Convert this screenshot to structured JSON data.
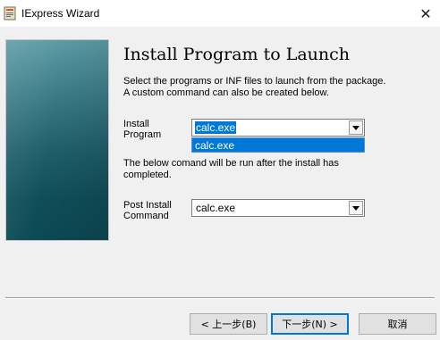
{
  "window": {
    "title": "IExpress Wizard",
    "close_glyph": "✕",
    "app_icon": "iexpress-icon"
  },
  "page": {
    "heading": "Install Program to Launch",
    "description": "Select the programs or INF files to launch from the package.  A custom command can also be created below."
  },
  "install_program": {
    "label": "Install\nProgram",
    "value": "calc.exe",
    "dropdown_options": [
      "calc.exe"
    ]
  },
  "note": "The below comand will be run after the install has completed.",
  "post_install": {
    "label": "Post Install\nCommand",
    "value": "calc.exe"
  },
  "buttons": {
    "back": "< 上一步(B)",
    "next": "下一步(N) >",
    "cancel": "取消"
  },
  "colors": {
    "selection": "#0078d7",
    "banner": "#1f5f6c"
  }
}
